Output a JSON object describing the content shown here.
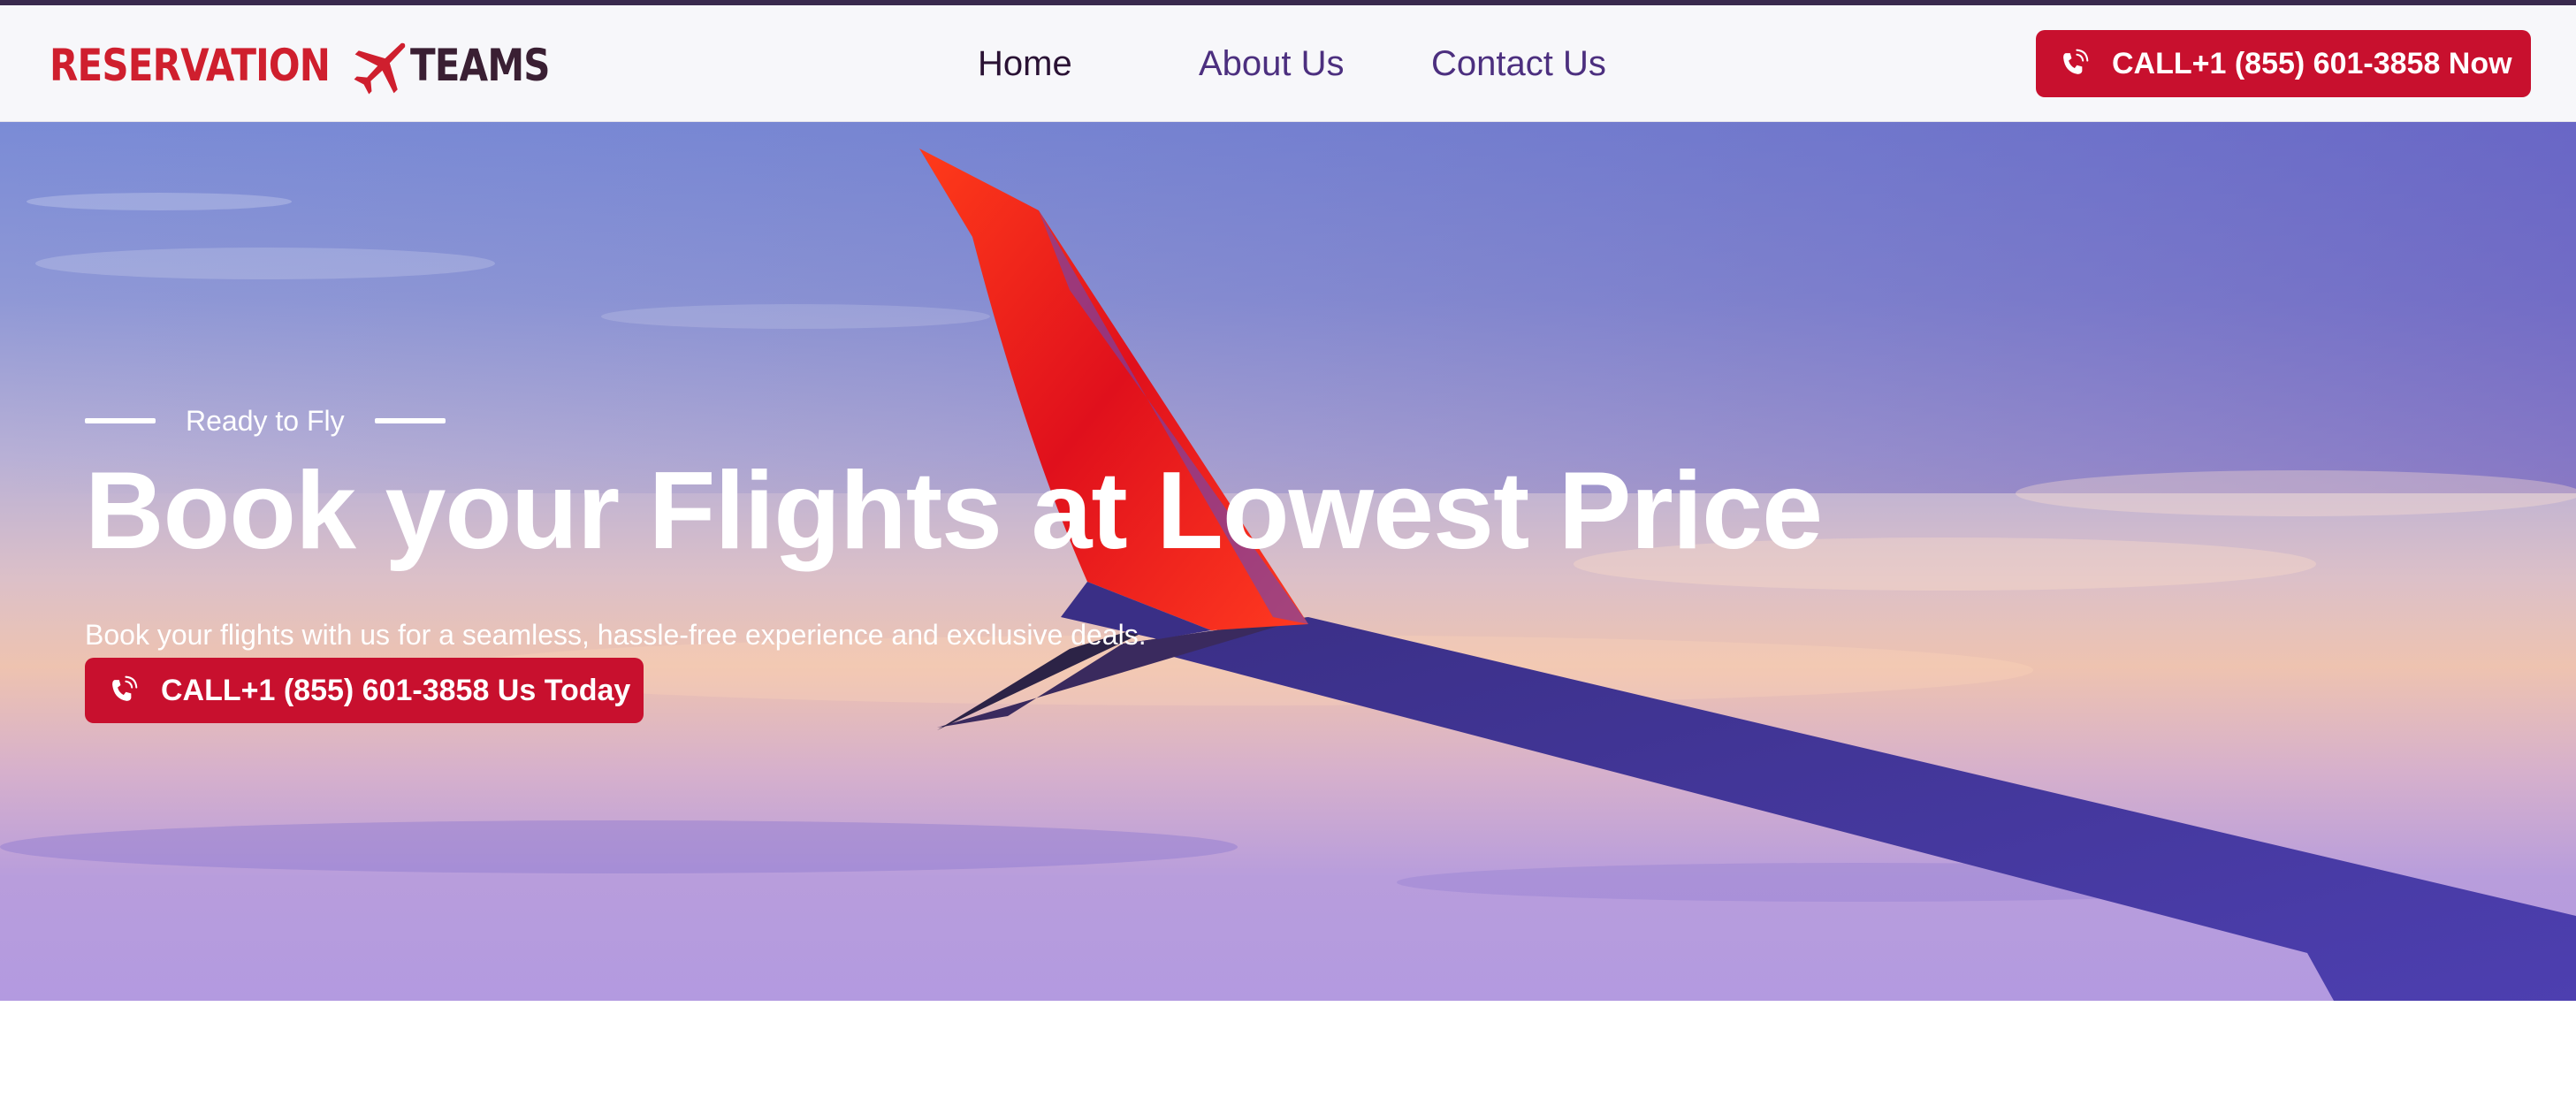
{
  "colors": {
    "brand_red": "#c8102e",
    "nav_text": "#4c2f7f",
    "nav_active": "#2a1234",
    "logo_dark": "#3a1f33"
  },
  "logo": {
    "word1": "RESERVATION",
    "word2": "TEAMS",
    "icon": "airplane-icon"
  },
  "nav": {
    "items": [
      {
        "label": "Home",
        "active": true
      },
      {
        "label": "About Us",
        "active": false
      },
      {
        "label": "Contact Us",
        "active": false
      }
    ],
    "cta": {
      "label": "CALL+1 (855) 601-3858 Now",
      "icon": "phone-icon"
    }
  },
  "hero": {
    "eyebrow": "Ready to Fly",
    "title": "Book your Flights at Lowest Price",
    "subtitle": "Book your flights with us for a seamless, hassle-free experience and exclusive deals.",
    "cta": {
      "label": "CALL+1 (855) 601-3858 Us Today",
      "icon": "phone-icon"
    },
    "background": "airplane-wing-sunset-sky-image"
  }
}
